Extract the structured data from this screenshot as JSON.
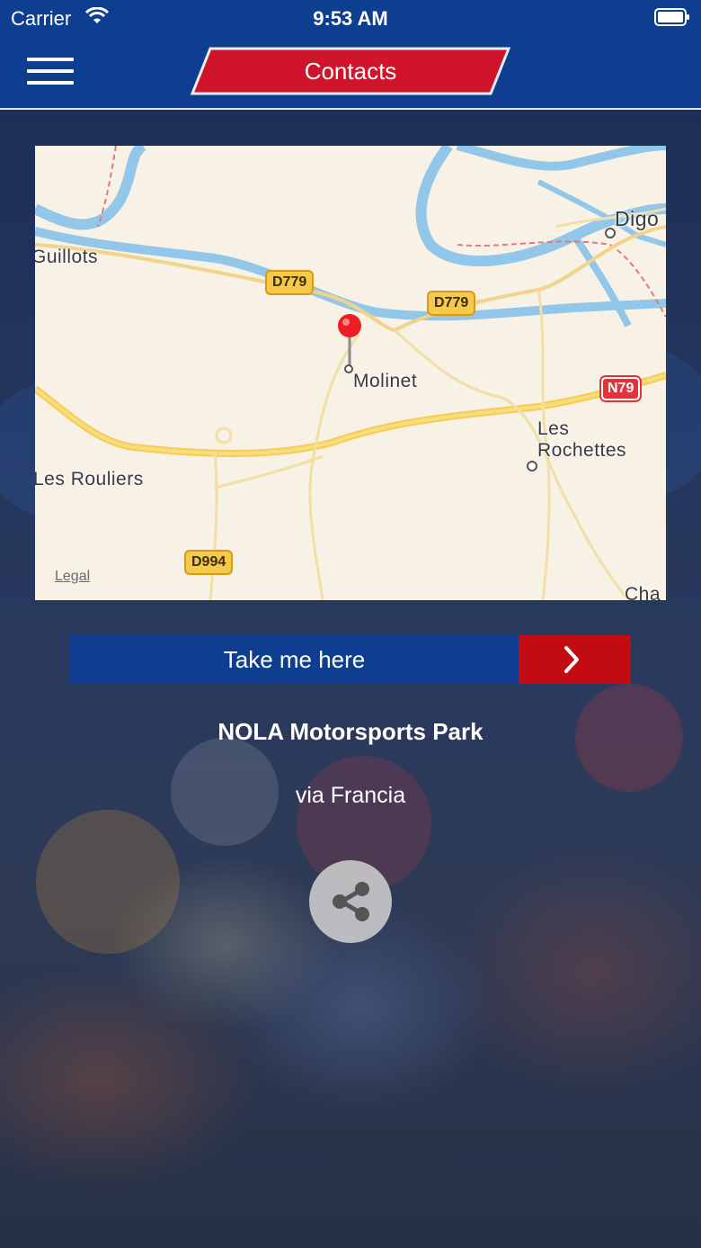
{
  "status_bar": {
    "carrier": "Carrier",
    "time": "9:53 AM"
  },
  "nav": {
    "title": "Contacts",
    "menu_icon": "hamburger-icon"
  },
  "map": {
    "labels": {
      "guillots": "Guillots",
      "digoin": "Digo",
      "molinet": "Molinet",
      "les_rochettes_1": "Les",
      "les_rochettes_2": "Rochettes",
      "les_rouliers": "Les Rouliers",
      "cha": "Cha"
    },
    "road_shields": {
      "d779_a": "D779",
      "d779_b": "D779",
      "n79": "N79",
      "d994": "D994"
    },
    "legal": "Legal",
    "pin_icon": "map-pin-icon"
  },
  "cta": {
    "label": "Take me here",
    "arrow_icon": "chevron-right-icon"
  },
  "place": {
    "name": "NOLA Motorsports Park",
    "address": "via Francia"
  },
  "share": {
    "icon": "share-icon"
  },
  "colors": {
    "nav_blue": "#0e3e8f",
    "accent_red": "#c30b12",
    "badge_red": "#d0142c"
  }
}
